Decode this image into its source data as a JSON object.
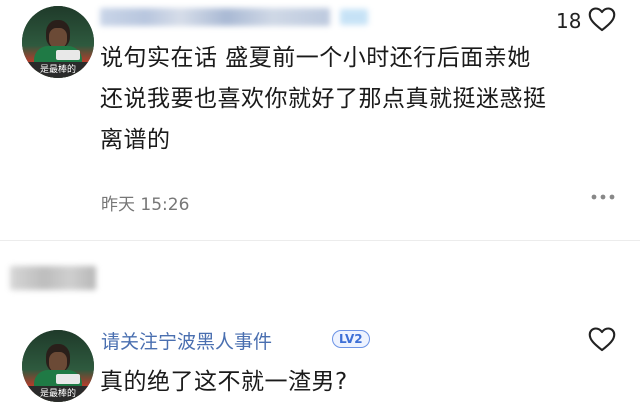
{
  "comments": [
    {
      "like_count": "18",
      "text_lines": [
        "说句实在话 盛夏前一个小时还行后面亲她",
        "还说我要也喜欢你就好了那点真就挺迷惑挺",
        "离谱的"
      ],
      "time": "昨天 15:26",
      "avatar_caption": "是最棒的"
    },
    {
      "username": "请关注宁波黑人事件",
      "level": "LV2",
      "text": "真的绝了这不就一渣男?",
      "avatar_caption": "是最棒的"
    }
  ],
  "colors": {
    "username_blue": "#4a6fb0",
    "badge_blue": "#3d6fd6",
    "muted_gray": "#777777"
  },
  "icons": [
    "heart-outline-icon",
    "more-dots-icon"
  ]
}
